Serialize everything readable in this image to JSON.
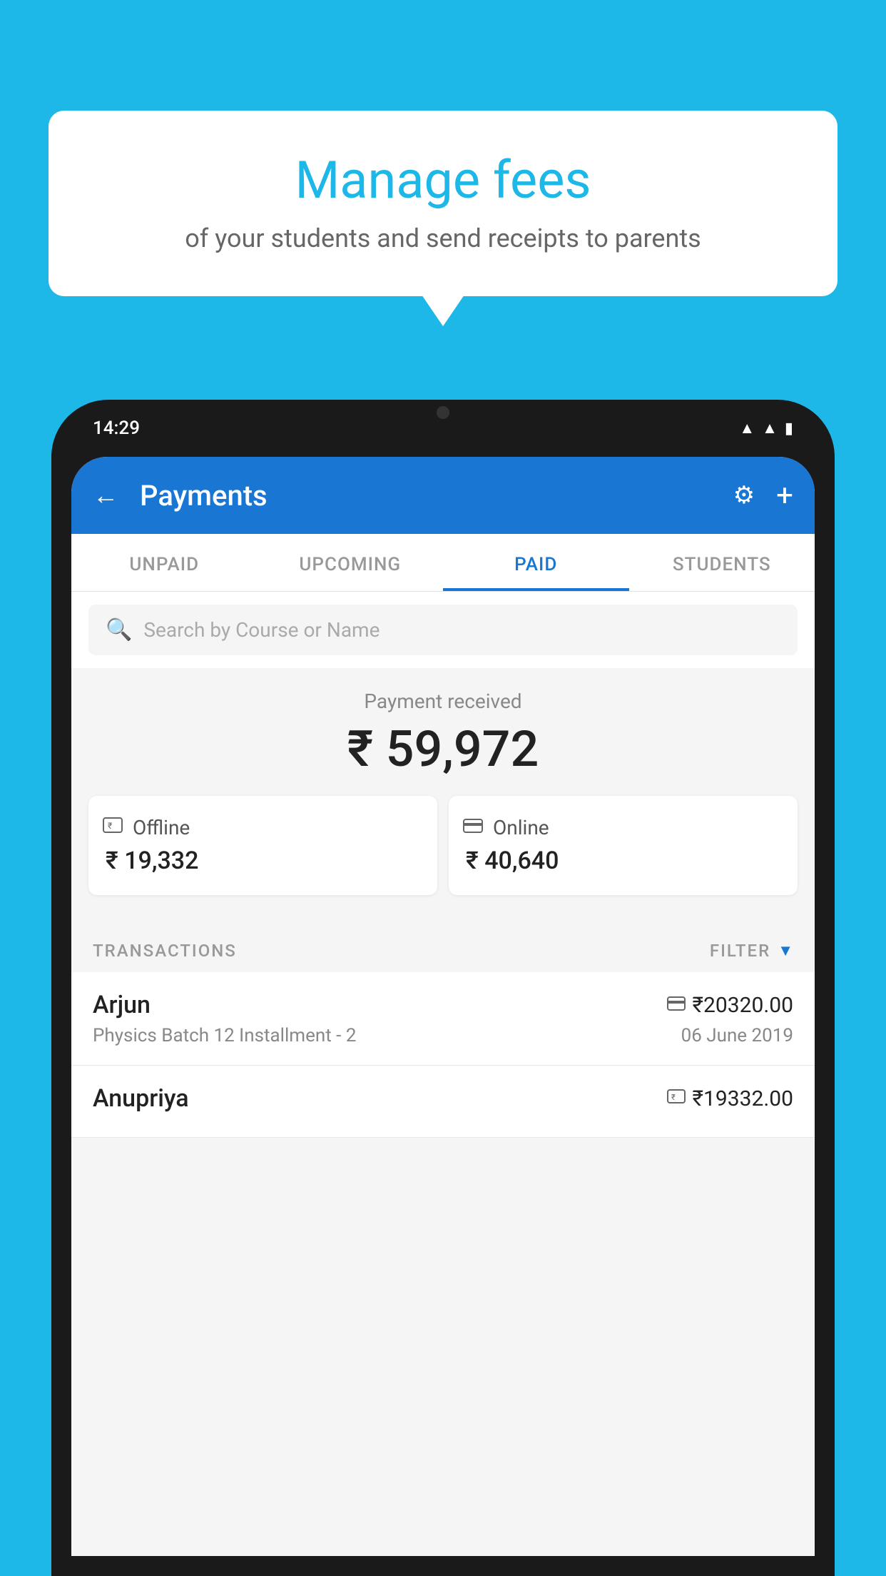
{
  "background_color": "#1eb8e8",
  "speech_bubble": {
    "title": "Manage fees",
    "subtitle": "of your students and send receipts to parents"
  },
  "phone": {
    "status_bar": {
      "time": "14:29",
      "wifi": "▲",
      "signal": "▲",
      "battery": "▮"
    },
    "app_bar": {
      "title": "Payments",
      "back_icon": "←",
      "settings_icon": "⚙",
      "add_icon": "+"
    },
    "tabs": [
      {
        "label": "UNPAID",
        "active": false
      },
      {
        "label": "UPCOMING",
        "active": false
      },
      {
        "label": "PAID",
        "active": true
      },
      {
        "label": "STUDENTS",
        "active": false
      }
    ],
    "search": {
      "placeholder": "Search by Course or Name"
    },
    "payment_summary": {
      "label": "Payment received",
      "amount": "₹ 59,972",
      "offline": {
        "label": "Offline",
        "amount": "₹ 19,332"
      },
      "online": {
        "label": "Online",
        "amount": "₹ 40,640"
      }
    },
    "transactions_section": {
      "label": "TRANSACTIONS",
      "filter_label": "FILTER"
    },
    "transactions": [
      {
        "name": "Arjun",
        "amount": "₹20320.00",
        "course": "Physics Batch 12 Installment - 2",
        "date": "06 June 2019",
        "payment_type": "online"
      },
      {
        "name": "Anupriya",
        "amount": "₹19332.00",
        "course": "",
        "date": "",
        "payment_type": "offline"
      }
    ]
  }
}
